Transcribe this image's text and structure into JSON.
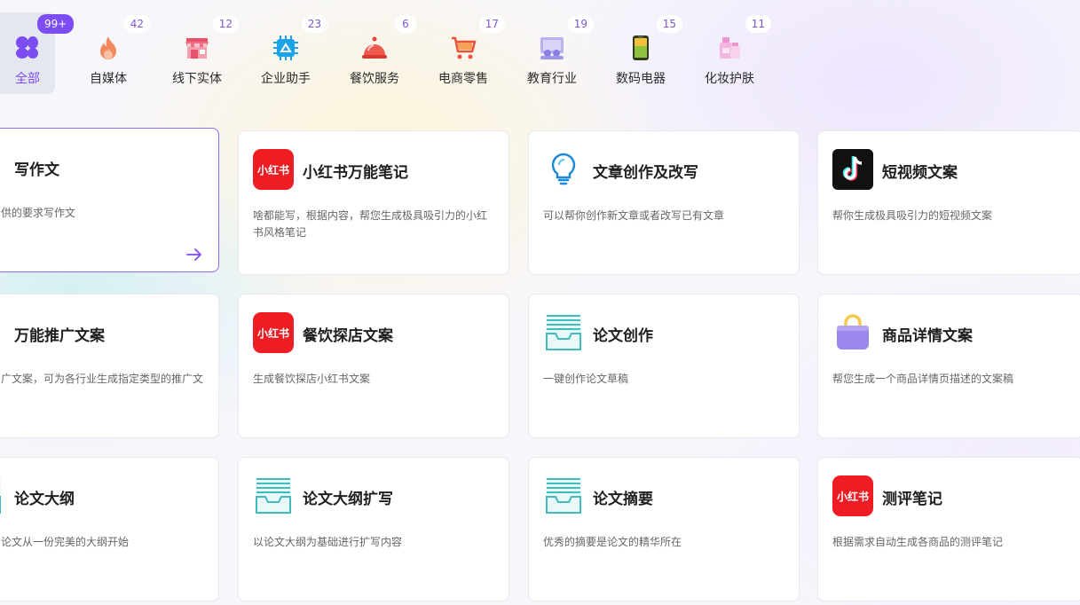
{
  "categories": [
    {
      "label": "全部",
      "count": "99+",
      "icon": "grid-icon"
    },
    {
      "label": "自媒体",
      "count": "42",
      "icon": "fire-icon"
    },
    {
      "label": "线下实体",
      "count": "12",
      "icon": "storefront-icon"
    },
    {
      "label": "企业助手",
      "count": "23",
      "icon": "chip-icon"
    },
    {
      "label": "餐饮服务",
      "count": "6",
      "icon": "food-cloche-icon"
    },
    {
      "label": "电商零售",
      "count": "17",
      "icon": "shopping-cart-icon"
    },
    {
      "label": "教育行业",
      "count": "19",
      "icon": "classroom-icon"
    },
    {
      "label": "数码电器",
      "count": "15",
      "icon": "phone-icon"
    },
    {
      "label": "化妆护肤",
      "count": "11",
      "icon": "cosmetics-icon"
    }
  ],
  "cards": [
    {
      "title": "写作文",
      "desc": "供的要求写作文",
      "icon": "",
      "selected": true
    },
    {
      "title": "小红书万能笔记",
      "desc": "啥都能写，根据内容，帮您生成极具吸引力的小红书风格笔记",
      "icon": "xiaohongshu-icon"
    },
    {
      "title": "文章创作及改写",
      "desc": "可以帮你创作新文章或者改写已有文章",
      "icon": "lightbulb-icon"
    },
    {
      "title": "短视频文案",
      "desc": "帮你生成极具吸引力的短视频文案",
      "icon": "tiktok-icon"
    },
    {
      "title": "万能推广文案",
      "desc": "广文案，可为各行业生成指定类型的推广文",
      "icon": ""
    },
    {
      "title": "餐饮探店文案",
      "desc": "生成餐饮探店小红书文案",
      "icon": "xiaohongshu-icon"
    },
    {
      "title": "论文创作",
      "desc": "一键创作论文草稿",
      "icon": "paper-tray-icon"
    },
    {
      "title": "商品详情文案",
      "desc": "帮您生成一个商品详情页描述的文案稿",
      "icon": "shopping-bag-icon"
    },
    {
      "title": "论文大纲",
      "desc": "论文从一份完美的大纲开始",
      "icon": "paper-tray-icon"
    },
    {
      "title": "论文大纲扩写",
      "desc": "以论文大纲为基础进行扩写内容",
      "icon": "paper-tray-icon"
    },
    {
      "title": "论文摘要",
      "desc": "优秀的摘要是论文的精华所在",
      "icon": "paper-tray-icon"
    },
    {
      "title": "测评笔记",
      "desc": "根据需求自动生成各商品的测评笔记",
      "icon": "xiaohongshu-icon"
    }
  ],
  "brand": {
    "xiaohongshu_text": "小红书"
  },
  "colors": {
    "accent": "#7b4df2",
    "xiaohongshu": "#ee1d23",
    "teal": "#3fbcc0"
  }
}
